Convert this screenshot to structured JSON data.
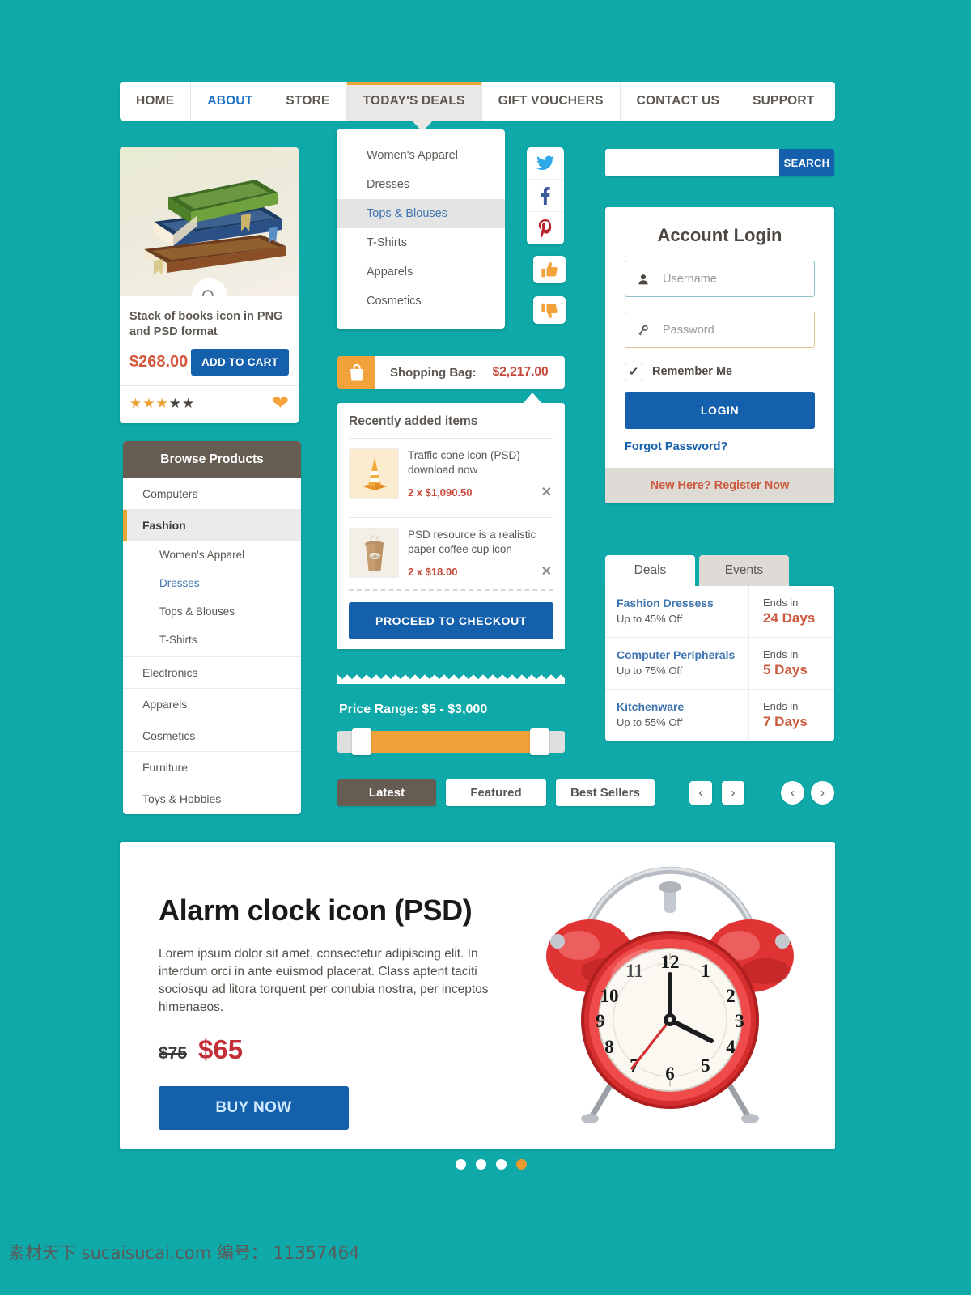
{
  "nav": {
    "items": [
      {
        "label": "HOME",
        "state": "normal"
      },
      {
        "label": "ABOUT",
        "state": "blue"
      },
      {
        "label": "STORE",
        "state": "normal"
      },
      {
        "label": "TODAY'S DEALS",
        "state": "active"
      },
      {
        "label": "GIFT VOUCHERS",
        "state": "normal"
      },
      {
        "label": "CONTACT US",
        "state": "normal"
      },
      {
        "label": "SUPPORT",
        "state": "normal"
      }
    ]
  },
  "dropdown": {
    "items": [
      {
        "label": "Women's Apparel",
        "selected": false
      },
      {
        "label": "Dresses",
        "selected": false
      },
      {
        "label": "Tops & Blouses",
        "selected": true
      },
      {
        "label": "T-Shirts",
        "selected": false
      },
      {
        "label": "Apparels",
        "selected": false
      },
      {
        "label": "Cosmetics",
        "selected": false
      }
    ]
  },
  "social": {
    "twitter": "twitter-icon",
    "facebook": "facebook-icon",
    "pinterest": "pinterest-icon",
    "thumb_up": "thumbs-up-icon",
    "thumb_down": "thumbs-down-icon"
  },
  "product": {
    "title": "Stack of books icon in PNG and PSD format",
    "price": "$268.00",
    "add_to_cart": "ADD TO CART",
    "rating_filled": 3,
    "rating_total": 5,
    "zoom_icon": "magnifier-icon",
    "favorite_icon": "heart-icon"
  },
  "browse": {
    "heading": "Browse Products",
    "items": [
      {
        "label": "Computers",
        "type": "top",
        "state": "normal"
      },
      {
        "label": "Fashion",
        "type": "top",
        "state": "active"
      },
      {
        "label": "Women's Apparel",
        "type": "sub",
        "state": "normal"
      },
      {
        "label": "Dresses",
        "type": "sub",
        "state": "link"
      },
      {
        "label": "Tops & Blouses",
        "type": "sub",
        "state": "normal"
      },
      {
        "label": "T-Shirts",
        "type": "sub",
        "state": "last"
      },
      {
        "label": "Electronics",
        "type": "top",
        "state": "normal"
      },
      {
        "label": "Apparels",
        "type": "top",
        "state": "normal"
      },
      {
        "label": "Cosmetics",
        "type": "top",
        "state": "normal"
      },
      {
        "label": "Furniture",
        "type": "top",
        "state": "normal"
      },
      {
        "label": "Toys & Hobbies",
        "type": "top",
        "state": "normal"
      }
    ]
  },
  "bag": {
    "icon": "shopping-bag-icon",
    "label": "Shopping Bag:",
    "total": "$2,217.00"
  },
  "cart": {
    "title": "Recently added items",
    "items": [
      {
        "name": "Traffic cone icon (PSD) download now",
        "price": "2 x $1,090.50",
        "thumb": "traffic-cone-thumb"
      },
      {
        "name": " PSD resource is a realistic paper coffee cup icon",
        "price": "2 x $18.00",
        "thumb": "coffee-cup-thumb"
      }
    ],
    "remove_icon": "close-icon",
    "checkout_label": "PROCEED TO CHECKOUT"
  },
  "price_range": {
    "label": "Price Range: $5 - $3,000",
    "min": "$5",
    "max": "$3,000"
  },
  "filters": {
    "tabs": [
      {
        "label": "Latest",
        "active": true
      },
      {
        "label": "Featured",
        "active": false
      },
      {
        "label": "Best Sellers",
        "active": false
      }
    ],
    "prev_icon": "chevron-left-icon",
    "next_icon": "chevron-right-icon"
  },
  "search": {
    "value": "",
    "placeholder": "",
    "button_label": "SEARCH"
  },
  "login": {
    "title": "Account Login",
    "username_placeholder": "Username",
    "username_value": "",
    "username_icon": "user-icon",
    "password_placeholder": "Password",
    "password_value": "",
    "password_icon": "key-icon",
    "remember_label": "Remember Me",
    "remember_checked": true,
    "check_icon": "check-icon",
    "login_button": "LOGIN",
    "forgot_link": "Forgot Password?",
    "register_link": "New Here? Register Now"
  },
  "deals": {
    "tabs": [
      {
        "label": "Deals",
        "active": true
      },
      {
        "label": "Events",
        "active": false
      }
    ],
    "rows": [
      {
        "name": "Fashion Dressess",
        "discount": "Up to 45% Off",
        "ends_label": "Ends in",
        "days": "24 Days"
      },
      {
        "name": "Computer Peripherals",
        "discount": "Up to 75% Off",
        "ends_label": "Ends in",
        "days": "5 Days"
      },
      {
        "name": "Kitchenware",
        "discount": "Up to 55% Off",
        "ends_label": "Ends in",
        "days": "7 Days"
      }
    ]
  },
  "banner": {
    "heading": "Alarm clock icon (PSD)",
    "body": "Lorem ipsum dolor sit amet, consectetur adipiscing elit. In interdum orci in ante euismod placerat. Class aptent taciti sociosqu ad litora torquent per conubia nostra, per inceptos himenaeos.",
    "old_price": "$75",
    "new_price": "$65",
    "buy_label": "BUY NOW",
    "image": "alarm-clock-image"
  },
  "carousel": {
    "dots": 4,
    "active_index": 3
  },
  "watermark": "素材天下 sucaisucai.com  编号： 11357464",
  "colors": {
    "background": "#0ea9a8",
    "accent_orange": "#f2a23a",
    "accent_blue": "#1560ac",
    "accent_red": "#c6493a",
    "brown": "#675c52"
  }
}
